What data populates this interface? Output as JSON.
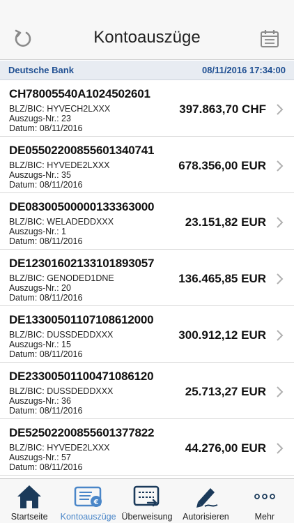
{
  "header": {
    "title": "Kontoauszüge",
    "refresh_icon": "refresh-icon",
    "calendar_icon": "calendar-icon"
  },
  "section": {
    "bank": "Deutsche Bank",
    "datetime": "08/11/2016 17:34:00"
  },
  "statements": [
    {
      "iban": "CH78005540A1024502601",
      "bic_label": "BLZ/BIC:",
      "bic": "HYVECH2LXXX",
      "nr_label": "Auszugs-Nr.:",
      "nr": "23",
      "date_label": "Datum:",
      "date": "08/11/2016",
      "amount": "397.863,70 CHF"
    },
    {
      "iban": "DE05502200855601340741",
      "bic_label": "BLZ/BIC:",
      "bic": "HYVEDE2LXXX",
      "nr_label": "Auszugs-Nr.:",
      "nr": "35",
      "date_label": "Datum:",
      "date": "08/11/2016",
      "amount": "678.356,00 EUR"
    },
    {
      "iban": "DE08300500000133363000",
      "bic_label": "BLZ/BIC:",
      "bic": "WELADEDDXXX",
      "nr_label": "Auszugs-Nr.:",
      "nr": "1",
      "date_label": "Datum:",
      "date": "08/11/2016",
      "amount": "23.151,82 EUR"
    },
    {
      "iban": "DE12301602133101893057",
      "bic_label": "BLZ/BIC:",
      "bic": "GENODED1DNE",
      "nr_label": "Auszugs-Nr.:",
      "nr": "20",
      "date_label": "Datum:",
      "date": "08/11/2016",
      "amount": "136.465,85 EUR"
    },
    {
      "iban": "DE13300501107108612000",
      "bic_label": "BLZ/BIC:",
      "bic": "DUSSDEDDXXX",
      "nr_label": "Auszugs-Nr.:",
      "nr": "15",
      "date_label": "Datum:",
      "date": "08/11/2016",
      "amount": "300.912,12 EUR"
    },
    {
      "iban": "DE23300501100471086120",
      "bic_label": "BLZ/BIC:",
      "bic": "DUSSDEDDXXX",
      "nr_label": "Auszugs-Nr.:",
      "nr": "36",
      "date_label": "Datum:",
      "date": "08/11/2016",
      "amount": "25.713,27 EUR"
    },
    {
      "iban": "DE52502200855601377822",
      "bic_label": "BLZ/BIC:",
      "bic": "HYVEDE2LXXX",
      "nr_label": "Auszugs-Nr.:",
      "nr": "57",
      "date_label": "Datum:",
      "date": "08/11/2016",
      "amount": "44.276,00 EUR"
    }
  ],
  "tabs": [
    {
      "label": "Startseite",
      "icon": "home-icon",
      "active": false
    },
    {
      "label": "Kontoauszüge",
      "icon": "statement-icon",
      "active": true
    },
    {
      "label": "Überweisung",
      "icon": "transfer-icon",
      "active": false
    },
    {
      "label": "Autorisieren",
      "icon": "signature-icon",
      "active": false
    },
    {
      "label": "Mehr",
      "icon": "more-icon",
      "active": false
    }
  ],
  "colors": {
    "accent": "#4a86c8",
    "section_text": "#1f4f92",
    "icon_dark": "#1b3a5a"
  }
}
